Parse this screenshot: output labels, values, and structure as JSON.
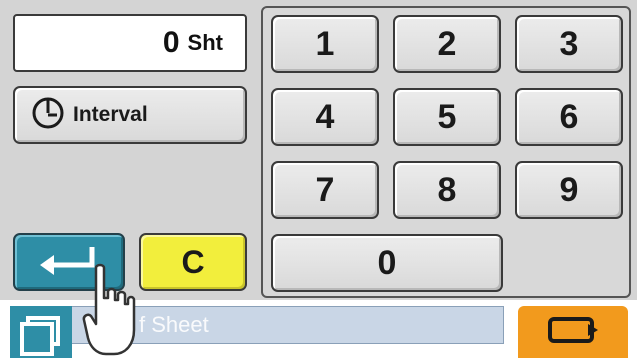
{
  "counter": {
    "value": "0",
    "unit": "Sht"
  },
  "interval": {
    "label": "Interval",
    "icon": "timer-icon"
  },
  "enter": {
    "icon": "enter-arrow-icon"
  },
  "clear": {
    "label": "C"
  },
  "keypad": {
    "keys": [
      "1",
      "2",
      "3",
      "4",
      "5",
      "6",
      "7",
      "8",
      "9"
    ],
    "zero": "0"
  },
  "status_bar": {
    "text": "f Sheet",
    "icon": "documents-icon"
  },
  "action_button": {
    "icon": "feed-icon"
  },
  "colors": {
    "accent": "#2e8ea6",
    "clear": "#f2ee3c",
    "action": "#f29a1d",
    "panel": "#d4d4d4"
  }
}
